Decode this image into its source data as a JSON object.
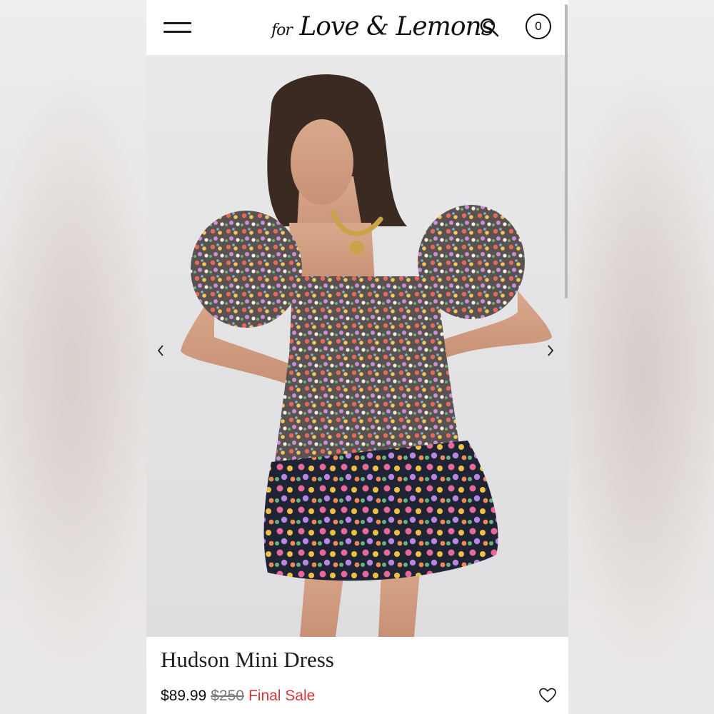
{
  "header": {
    "logo_text": "for Love & Lemons",
    "logo_prefix": "for",
    "logo_main": "Love & Lemons",
    "cart_count": "0"
  },
  "icons": {
    "menu": "hamburger-icon",
    "search": "search-icon",
    "cart": "cart-count-badge",
    "prev": "chevron-left-icon",
    "next": "chevron-right-icon",
    "wishlist": "heart-icon"
  },
  "product": {
    "name": "Hudson Mini Dress",
    "price": "$89.99",
    "original_price": "$250",
    "sale_label": "Final Sale"
  },
  "colors": {
    "sale": "#d2383b",
    "text": "#111111",
    "strike": "#7a7a7a"
  }
}
